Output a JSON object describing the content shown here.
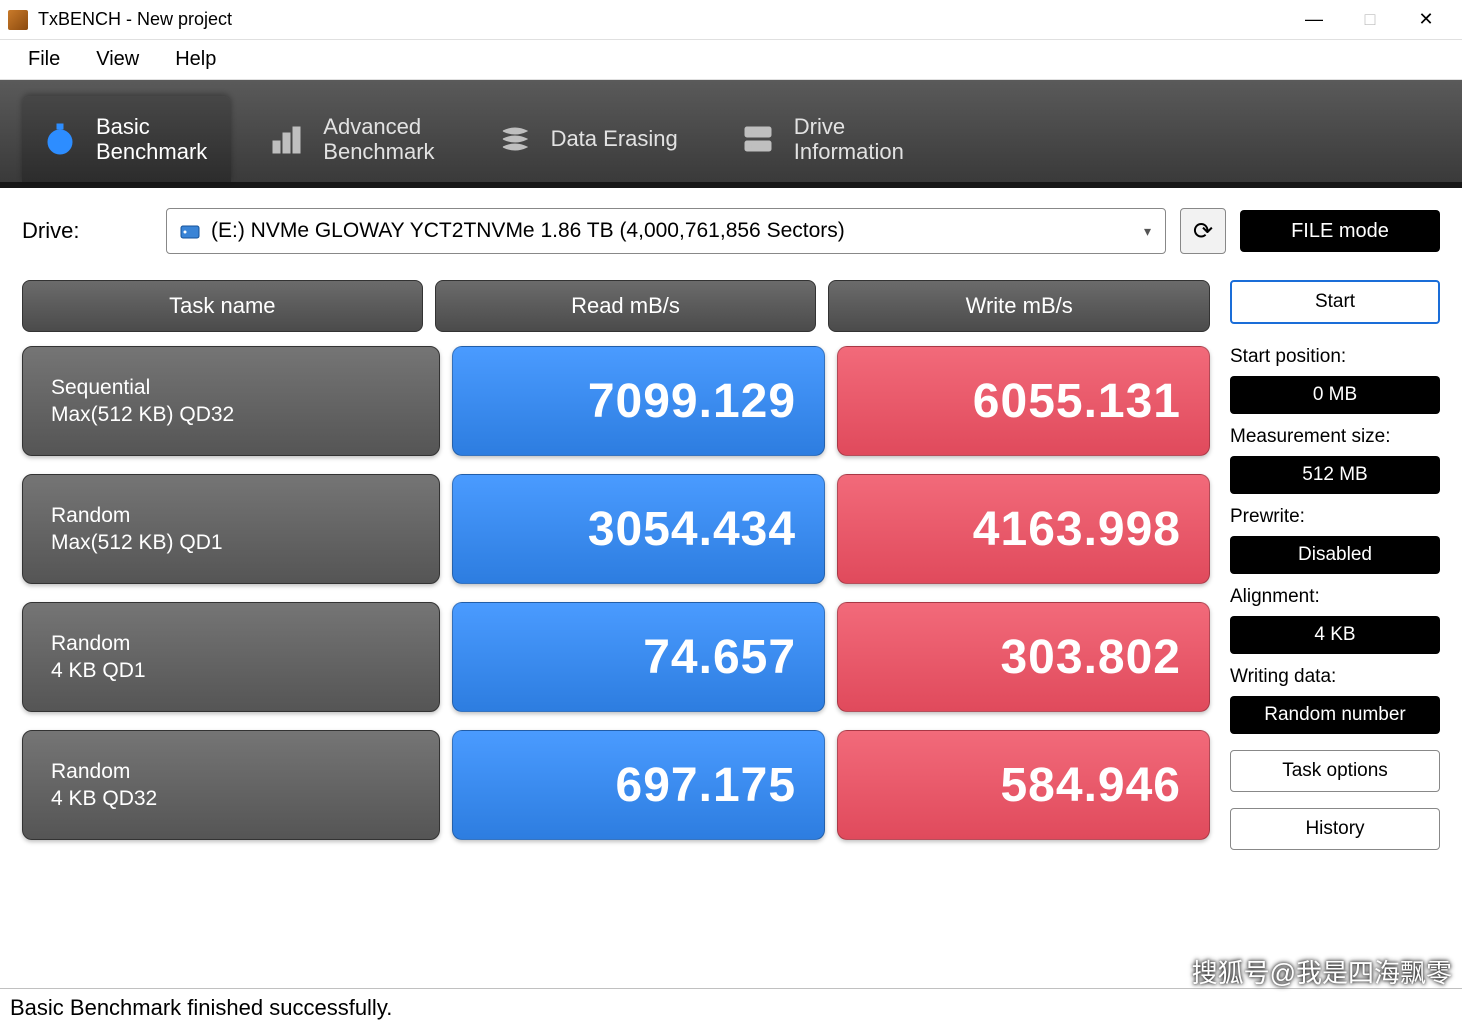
{
  "window": {
    "title": "TxBENCH - New project"
  },
  "menu": {
    "file": "File",
    "view": "View",
    "help": "Help"
  },
  "tabs": {
    "basic": {
      "l1": "Basic",
      "l2": "Benchmark"
    },
    "advanced": {
      "l1": "Advanced",
      "l2": "Benchmark"
    },
    "erase": {
      "l1": "Data Erasing"
    },
    "info": {
      "l1": "Drive",
      "l2": "Information"
    }
  },
  "drive": {
    "label": "Drive:",
    "value": "(E:) NVMe GLOWAY YCT2TNVMe  1.86 TB (4,000,761,856 Sectors)",
    "filemode": "FILE mode"
  },
  "headers": {
    "task": "Task name",
    "read": "Read mB/s",
    "write": "Write mB/s"
  },
  "rows": [
    {
      "t1": "Sequential",
      "t2": "Max(512 KB) QD32",
      "read": "7099.129",
      "write": "6055.131"
    },
    {
      "t1": "Random",
      "t2": "Max(512 KB) QD1",
      "read": "3054.434",
      "write": "4163.998"
    },
    {
      "t1": "Random",
      "t2": "4 KB QD1",
      "read": "74.657",
      "write": "303.802"
    },
    {
      "t1": "Random",
      "t2": "4 KB QD32",
      "read": "697.175",
      "write": "584.946"
    }
  ],
  "sidebar": {
    "start": "Start",
    "start_pos_label": "Start position:",
    "start_pos_value": "0 MB",
    "meas_label": "Measurement size:",
    "meas_value": "512 MB",
    "prewrite_label": "Prewrite:",
    "prewrite_value": "Disabled",
    "align_label": "Alignment:",
    "align_value": "4 KB",
    "wdata_label": "Writing data:",
    "wdata_value": "Random number",
    "task_options": "Task options",
    "history": "History"
  },
  "status": "Basic Benchmark finished successfully.",
  "watermark": "搜狐号@我是四海飘零"
}
